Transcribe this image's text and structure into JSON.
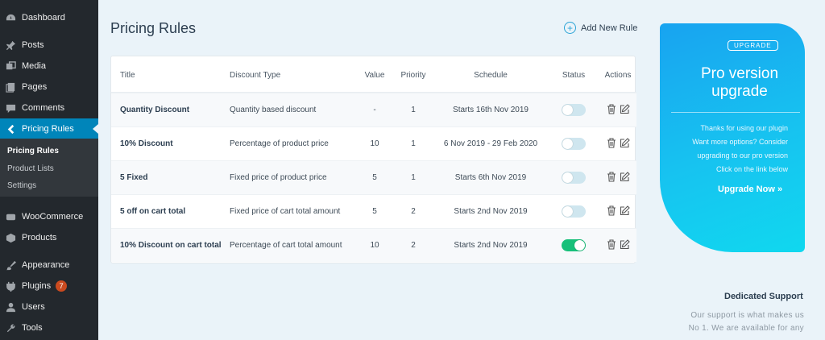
{
  "sidebar": {
    "items": [
      {
        "label": "Dashboard",
        "icon": "dashboard-icon"
      },
      {
        "label": "Posts",
        "icon": "pin-icon"
      },
      {
        "label": "Media",
        "icon": "media-icon"
      },
      {
        "label": "Pages",
        "icon": "pages-icon"
      },
      {
        "label": "Comments",
        "icon": "comment-icon"
      },
      {
        "label": "Pricing Rules",
        "icon": "chevron-left-icon"
      },
      {
        "label": "WooCommerce",
        "icon": "woo-icon"
      },
      {
        "label": "Products",
        "icon": "box-icon"
      },
      {
        "label": "Appearance",
        "icon": "brush-icon"
      },
      {
        "label": "Plugins",
        "icon": "plug-icon",
        "badge": "7"
      },
      {
        "label": "Users",
        "icon": "user-icon"
      },
      {
        "label": "Tools",
        "icon": "wrench-icon"
      }
    ],
    "submenu": [
      "Pricing Rules",
      "Product Lists",
      "Settings"
    ]
  },
  "header": {
    "title": "Pricing Rules",
    "add_rule_label": "Add New Rule"
  },
  "table": {
    "columns": {
      "title": "Title",
      "discount_type": "Discount Type",
      "value": "Value",
      "priority": "Priority",
      "schedule": "Schedule",
      "status": "Status",
      "actions": "Actions"
    },
    "rows": [
      {
        "title": "Quantity Discount",
        "discount_type": "Quantity based discount",
        "value": "-",
        "priority": "1",
        "schedule": "Starts 16th Nov 2019",
        "enabled": false
      },
      {
        "title": "10% Discount",
        "discount_type": "Percentage of product price",
        "value": "10",
        "priority": "1",
        "schedule": "6 Nov 2019 - 29 Feb 2020",
        "enabled": false
      },
      {
        "title": "5 Fixed",
        "discount_type": "Fixed price of product price",
        "value": "5",
        "priority": "1",
        "schedule": "Starts 6th Nov 2019",
        "enabled": false
      },
      {
        "title": "5 off on cart total",
        "discount_type": "Fixed price of cart total amount",
        "value": "5",
        "priority": "2",
        "schedule": "Starts 2nd Nov 2019",
        "enabled": false
      },
      {
        "title": "10% Discount on cart total",
        "discount_type": "Percentage of cart total amount",
        "value": "10",
        "priority": "2",
        "schedule": "Starts 2nd Nov 2019",
        "enabled": true
      }
    ]
  },
  "upgrade": {
    "badge": "UPGRADE",
    "title": "Pro version upgrade",
    "lines": [
      "Thanks for using our plugin",
      "Want more options? Consider",
      "upgrading to our pro version",
      "Click on the link below"
    ],
    "link_label": "Upgrade Now »"
  },
  "support": {
    "title": "Dedicated Support",
    "lines": [
      "Our support is what makes us",
      "No 1. We are available for any"
    ]
  },
  "colors": {
    "sidebar_bg": "#23282d",
    "active_menu": "#0085ba",
    "toggle_on": "#18c07a",
    "toggle_off": "#cfe6ef",
    "upgrade_gradient_start": "#18a3f0",
    "upgrade_gradient_end": "#10d8ef"
  }
}
